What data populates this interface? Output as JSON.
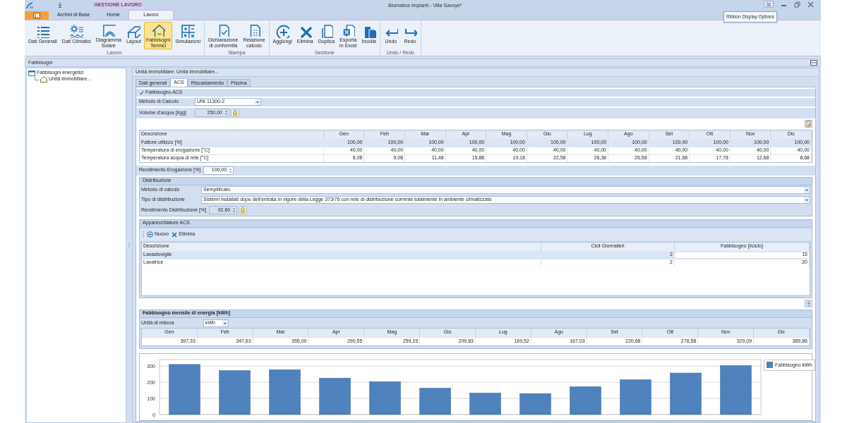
{
  "window": {
    "title": "Blumatica Impianti - Villa Savoye*",
    "context_tab": "GESTIONE LAVORO",
    "tooltip": "Ribbon Display Options"
  },
  "ribbon_tabs": [
    {
      "label": "Archivi di Base",
      "selected": false
    },
    {
      "label": "Home",
      "selected": false
    },
    {
      "label": "Lavoro",
      "selected": true
    }
  ],
  "ribbon_groups": [
    {
      "title": "Lavoro",
      "buttons": [
        {
          "label": "Dati Generali",
          "selected": false
        },
        {
          "label": "Dati Climatici",
          "selected": false
        },
        {
          "label": "Diagramma\nSolare",
          "selected": false
        },
        {
          "label": "Layout",
          "selected": false
        },
        {
          "label": "Fabbisogni\nTermici",
          "selected": true
        },
        {
          "label": "Simulazioni",
          "selected": false
        }
      ]
    },
    {
      "title": "Stampa",
      "buttons": [
        {
          "label": "Dichiarazione\ndi conformità",
          "selected": false
        },
        {
          "label": "Relazione\ncalcolo",
          "selected": false
        }
      ]
    },
    {
      "title": "Gestione",
      "buttons": [
        {
          "label": "Aggiungi",
          "selected": false
        },
        {
          "label": "Elimina",
          "selected": false
        },
        {
          "label": "Duplica",
          "selected": false
        },
        {
          "label": "Esporta\nin Excel",
          "selected": false
        },
        {
          "label": "Incolla",
          "selected": false
        }
      ]
    },
    {
      "title": "Undo / Redo",
      "buttons": [
        {
          "label": "Undo",
          "selected": false
        },
        {
          "label": "Redo",
          "selected": false
        }
      ]
    }
  ],
  "panel_title": "Fabbisogni",
  "tree": [
    {
      "label": "Fabbisogni energetici",
      "children": [
        {
          "label": "Unità immobiliare..."
        }
      ]
    }
  ],
  "main": {
    "title": "Unità immobiliare: Unità immobiliare...",
    "tabs": [
      {
        "label": "Dati generali",
        "selected": false
      },
      {
        "label": "ACS",
        "selected": true
      },
      {
        "label": "Riscaldamento",
        "selected": false
      },
      {
        "label": "Piscina",
        "selected": false
      }
    ],
    "fabbisogno_acs": {
      "label": "Fabbisogno ACS",
      "checked": true
    },
    "metodo": {
      "label": "Metodo di Calcolo",
      "value": "UNI 11300-2"
    },
    "volume": {
      "label": "Volume d'acqua [l/gg]",
      "value": "250,00"
    },
    "acs_table": {
      "columns": [
        "Descrizione",
        "Gen",
        "Feb",
        "Mar",
        "Apr",
        "Mag",
        "Giu",
        "Lug",
        "Ago",
        "Set",
        "Ott",
        "Nov",
        "Dic"
      ],
      "rows": [
        {
          "cells": [
            "Fattore utilizzo [%]",
            "100,00",
            "100,00",
            "100,00",
            "100,00",
            "100,00",
            "100,00",
            "100,00",
            "100,00",
            "100,00",
            "100,00",
            "100,00",
            "100,00"
          ],
          "selected": true
        },
        {
          "cells": [
            "Temperatura di erogazione [°C]",
            "40,00",
            "40,00",
            "40,00",
            "40,00",
            "40,00",
            "40,00",
            "40,00",
            "40,00",
            "40,00",
            "40,00",
            "40,00",
            "40,00"
          ],
          "selected": false
        },
        {
          "cells": [
            "Temperatura acqua di rete [°C]",
            "8,08",
            "9,08",
            "11,48",
            "15,88",
            "19,18",
            "22,58",
            "26,38",
            "26,58",
            "21,68",
            "17,78",
            "12,68",
            "8,68"
          ],
          "selected": false
        }
      ]
    },
    "rendimento_erogazione": {
      "label": "Rendimento Erogazione [%]",
      "value": "100,00"
    },
    "distribuzione": {
      "title": "Distribuzione",
      "metodo_label": "Metodo di calcolo",
      "metodo_value": "Semplificato",
      "tipo_label": "Tipo di distribuzione",
      "tipo_value": "Sistemi installati dopo dell'entrata in vigore della Legge 373/76 con rete di distribuzione corrente totalmente in ambiente climatizzato",
      "rendimento_label": "Rendimento Distribuzione [%]",
      "rendimento_value": "92,60"
    },
    "apparecchiature": {
      "title": "Apparecchiature ACS",
      "toolbar": [
        "Nuovo",
        "Elimina"
      ],
      "columns": [
        "Descrizione",
        "Cicli Giornalieri",
        "Fabbisogno [l/ciclo]"
      ],
      "rows": [
        {
          "cells": [
            "Lavastoviglie",
            "2",
            "15"
          ],
          "selected": true
        },
        {
          "cells": [
            "Lavatrice",
            "2",
            "20"
          ],
          "selected": false
        }
      ]
    },
    "fabbisogno_mensile": {
      "title": "Fabbisogno mensile di energia [kWh]",
      "unit_label": "Unità di misura",
      "unit_value": "kWh",
      "columns": [
        "Gen",
        "Feb",
        "Mar",
        "Apr",
        "Mag",
        "Giu",
        "Lug",
        "Ago",
        "Set",
        "Ott",
        "Nov",
        "Dic"
      ],
      "values": [
        "397,33",
        "347,63",
        "355,00",
        "290,55",
        "259,15",
        "209,83",
        "169,52",
        "167,03",
        "220,68",
        "276,58",
        "329,09",
        "389,86"
      ],
      "chart_data": {
        "type": "bar",
        "grid": true,
        "series": [
          {
            "name": "Fabbisogno kWh",
            "color": "#4f81bd",
            "values": [
              310,
              272,
              277,
              225,
              203,
              163,
              133,
              130,
              172,
              215,
              257,
              303
            ]
          }
        ],
        "ylim": [
          0,
          340
        ],
        "yticks": [
          0,
          100,
          200,
          300
        ]
      }
    }
  }
}
